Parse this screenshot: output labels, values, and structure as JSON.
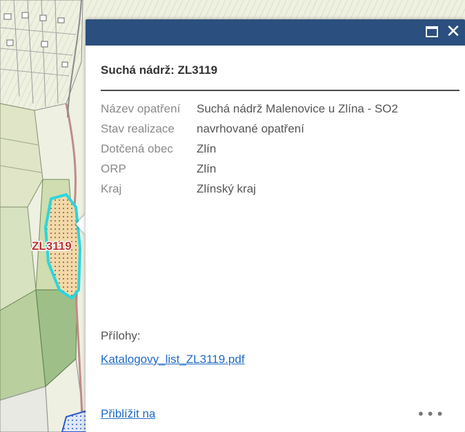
{
  "map": {
    "feature_label": "ZL3119",
    "feature_outline_color": "#2ad6dc",
    "feature_fill_color": "#f2d9a8"
  },
  "popup": {
    "header_color": "#2b4f7e",
    "maximize_icon": "maximize-icon",
    "close_icon": "close-icon",
    "close_glyph": "✕",
    "title": "Suchá nádrž: ZL3119",
    "attributes": [
      {
        "label": "Název opatření",
        "value": "Suchá nádrž Malenovice u Zlína - SO2"
      },
      {
        "label": "Stav realizace",
        "value": "navrhované opatření"
      },
      {
        "label": "Dotčená obec",
        "value": "Zlín"
      },
      {
        "label": "ORP",
        "value": "Zlín"
      },
      {
        "label": "Kraj",
        "value": "Zlínský kraj"
      }
    ],
    "attachments_label": "Přílohy:",
    "attachment": "Katalogovy_list_ZL3119.pdf",
    "zoom_link": "Přiblížit na",
    "more_icon": "more-icon",
    "more_glyph": "•••"
  }
}
